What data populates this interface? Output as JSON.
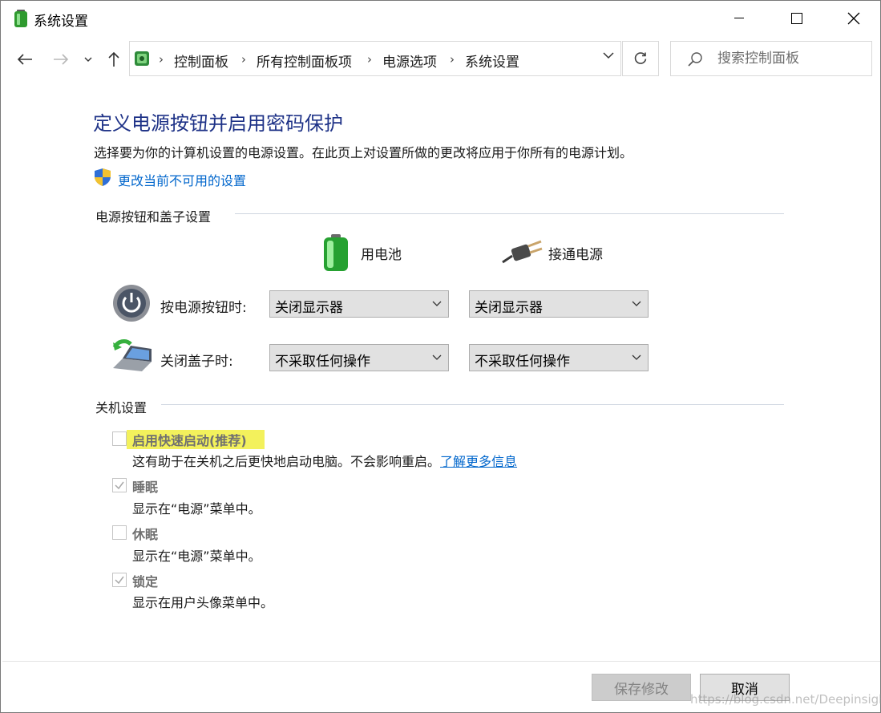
{
  "window": {
    "title": "系统设置"
  },
  "breadcrumb": [
    "控制面板",
    "所有控制面板项",
    "电源选项",
    "系统设置"
  ],
  "search": {
    "placeholder": "搜索控制面板"
  },
  "page": {
    "heading": "定义电源按钮并启用密码保护",
    "description": "选择要为你的计算机设置的电源设置。在此页上对设置所做的更改将应用于你所有的电源计划。",
    "change_link": "更改当前不可用的设置"
  },
  "power_section": {
    "label": "电源按钮和盖子设置",
    "columns": {
      "battery": "用电池",
      "plugged_in": "接通电源"
    },
    "rows": [
      {
        "label": "按电源按钮时:",
        "battery": "关闭显示器",
        "plugged_in": "关闭显示器"
      },
      {
        "label": "关闭盖子时:",
        "battery": "不采取任何操作",
        "plugged_in": "不采取任何操作"
      }
    ]
  },
  "shutdown_section": {
    "label": "关机设置",
    "options": [
      {
        "title": "启用快速启动(推荐)",
        "desc": "这有助于在关机之后更快地启动电脑。不会影响重启。",
        "link": "了解更多信息",
        "checked": false,
        "highlighted": true
      },
      {
        "title": "睡眠",
        "desc": "显示在“电源”菜单中。",
        "checked": true
      },
      {
        "title": "休眠",
        "desc": "显示在“电源”菜单中。",
        "checked": false
      },
      {
        "title": "锁定",
        "desc": "显示在用户头像菜单中。",
        "checked": true
      }
    ]
  },
  "buttons": {
    "save": "保存修改",
    "cancel": "取消"
  },
  "watermark": "https://blog.csdn.net/Deepinsight",
  "colors": {
    "heading": "#1e3287",
    "link": "#0066cc",
    "highlight": "#f3f15c"
  }
}
